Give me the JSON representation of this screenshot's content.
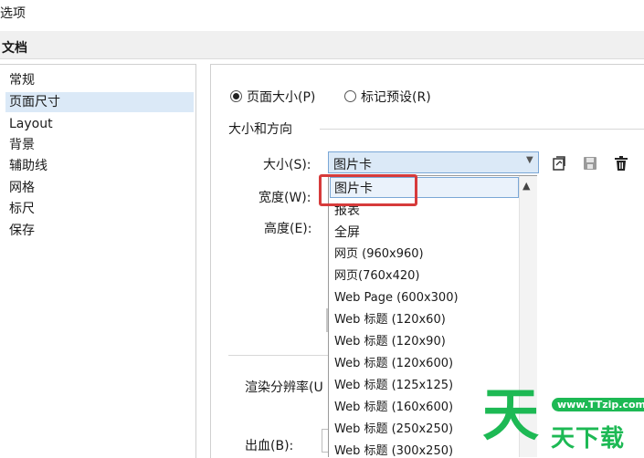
{
  "window": {
    "title": "选项"
  },
  "section": {
    "title": "文档"
  },
  "sidebar": {
    "items": [
      {
        "label": "常规"
      },
      {
        "label": "页面尺寸",
        "selected": true
      },
      {
        "label": "Layout"
      },
      {
        "label": "背景"
      },
      {
        "label": "辅助线"
      },
      {
        "label": "网格"
      },
      {
        "label": "标尺"
      },
      {
        "label": "保存"
      }
    ]
  },
  "mode": {
    "page_size_label": "页面大小(P)",
    "page_size_selected": true,
    "label_preset_label": "标记预设(R)",
    "label_preset_selected": false
  },
  "size_orientation": {
    "group_label": "大小和方向",
    "size_label": "大小(S):",
    "size_value": "图片卡",
    "width_label": "宽度(W):",
    "height_label": "高度(E):"
  },
  "other": {
    "resolution_label": "渲染分辨率(U",
    "bleed_label": "出血(B):"
  },
  "dropdown": {
    "items": [
      "图片卡",
      "报表",
      "全屏",
      "网页 (960x960)",
      "网页(760x420)",
      "Web Page (600x300)",
      "Web 标题 (120x60)",
      "Web 标题 (120x90)",
      "Web 标题 (120x600)",
      "Web 标题 (125x125)",
      "Web 标题 (160x600)",
      "Web 标题 (250x250)",
      "Web 标题 (300x250)"
    ]
  },
  "watermark": {
    "url": "www.TTzip.com",
    "logo": "天",
    "text": "天下载"
  },
  "colors": {
    "selection": "#dbe9f7",
    "highlight": "#d63b3b",
    "watermark": "#1db954"
  }
}
